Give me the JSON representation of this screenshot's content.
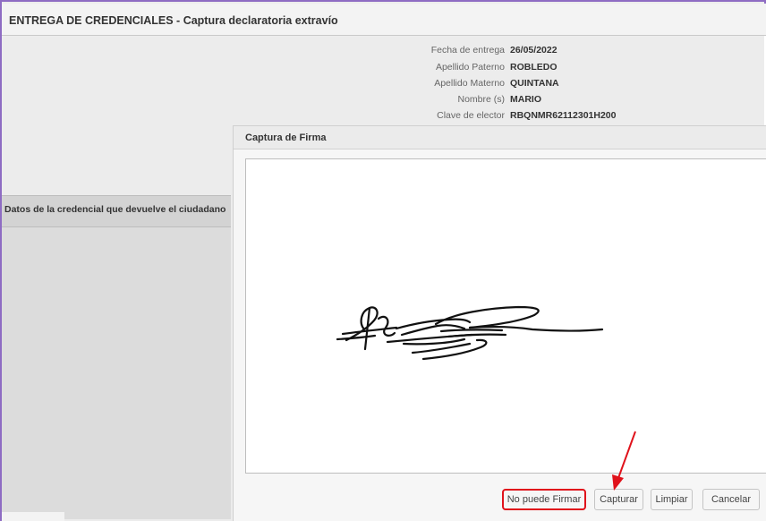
{
  "window": {
    "title": "ENTREGA DE CREDENCIALES - Captura declaratoria extravío"
  },
  "info": {
    "rows": [
      {
        "label": "Fecha de entrega",
        "value": "26/05/2022"
      },
      {
        "label": "Apellido Paterno",
        "value": "ROBLEDO"
      },
      {
        "label": "Apellido Materno",
        "value": "QUINTANA"
      },
      {
        "label": "Nombre (s)",
        "value": "MARIO"
      },
      {
        "label": "Clave de elector",
        "value": "RBQNMR62112301H200"
      }
    ]
  },
  "left_panel": {
    "header": "Datos de la credencial que devuelve el ciudadano"
  },
  "dialog": {
    "title": "Captura de Firma",
    "buttons": {
      "no_puede": "No puede Firmar",
      "capturar": "Capturar",
      "limpiar": "Limpiar",
      "cancelar": "Cancelar"
    }
  },
  "colors": {
    "frame": "#8e6cc3",
    "highlight": "#e0121b",
    "arrow": "#e0121b"
  }
}
